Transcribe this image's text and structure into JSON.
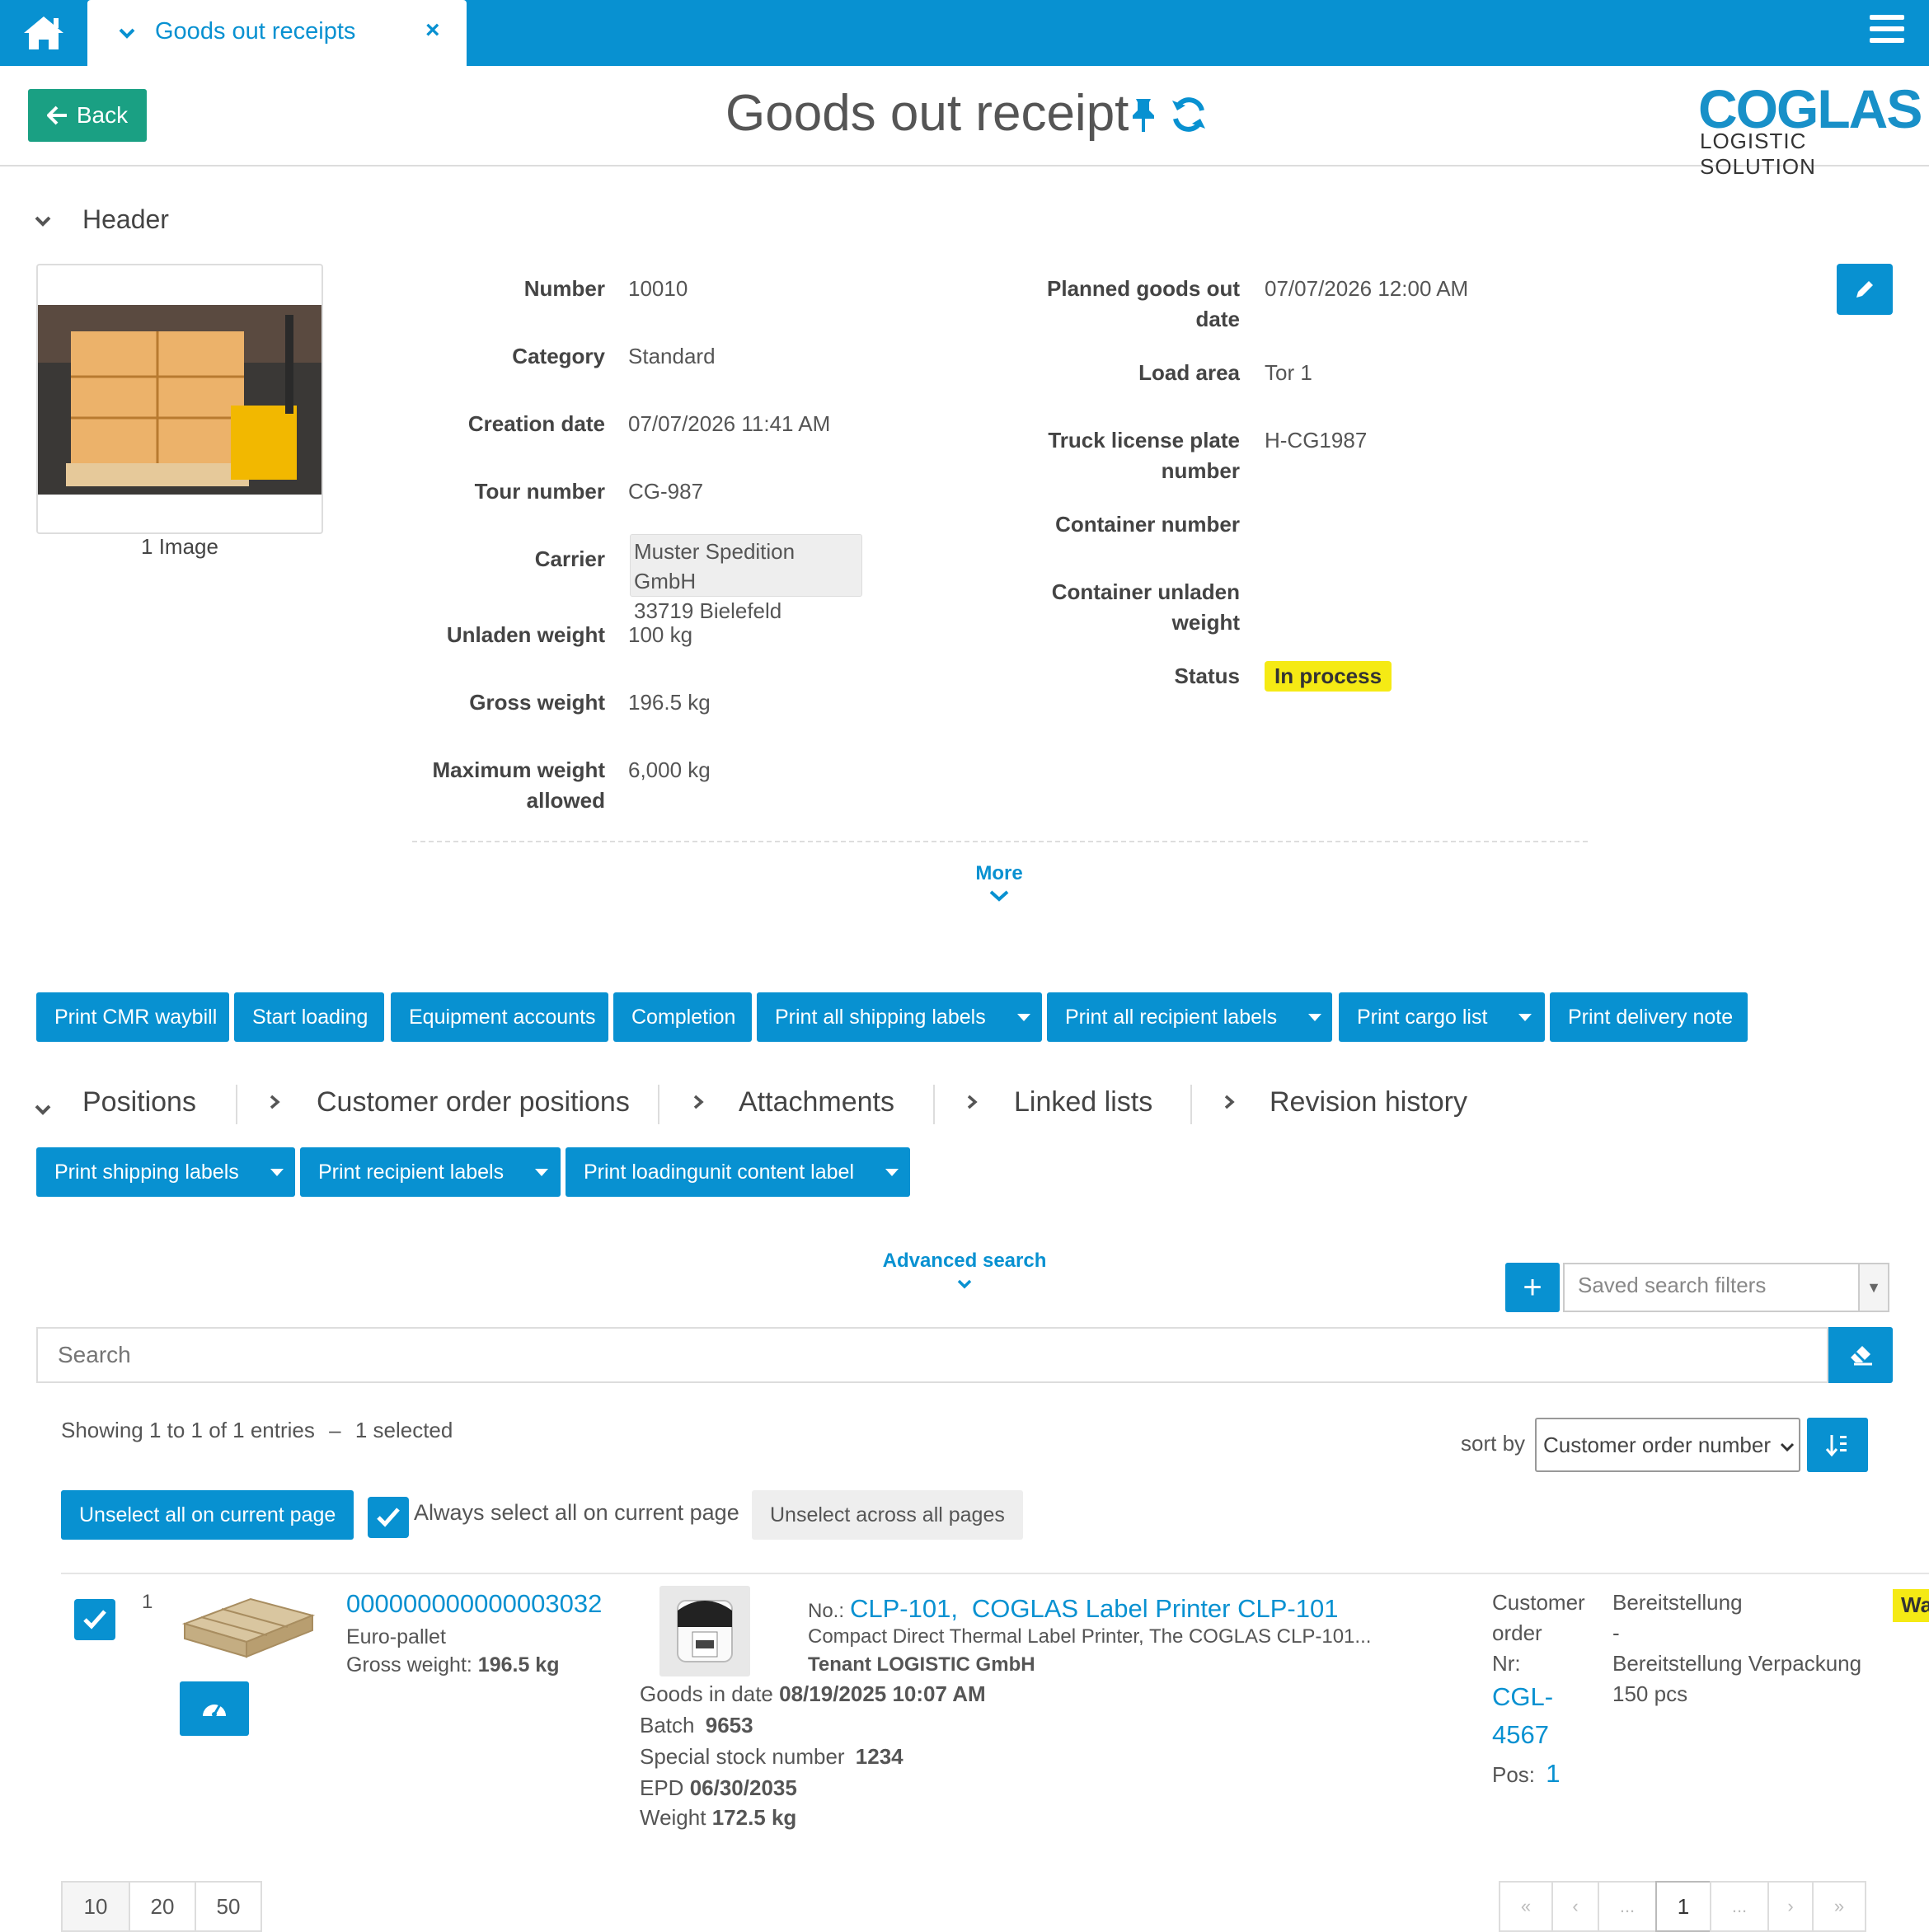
{
  "tab": {
    "label": "Goods out receipts"
  },
  "header": {
    "back_label": "Back",
    "title": "Goods out receipt",
    "logo_main": "COGLAS",
    "logo_sub": "LOGISTIC SOLUTION"
  },
  "header_section": {
    "title": "Header",
    "image_caption": "1 Image",
    "fields_left": [
      {
        "label": "Number",
        "value": "10010"
      },
      {
        "label": "Category",
        "value": "Standard"
      },
      {
        "label": "Creation date",
        "value": "07/07/2026 11:41 AM"
      },
      {
        "label": "Tour number",
        "value": "CG-987"
      },
      {
        "label": "Carrier",
        "value_line1": "Muster Spedition GmbH",
        "value_line2": "33719 Bielefeld"
      },
      {
        "label": "Unladen weight",
        "value": "100 kg"
      },
      {
        "label": "Gross weight",
        "value": "196.5 kg"
      },
      {
        "label_line1": "Maximum weight",
        "label_line2": "allowed",
        "value": "6,000 kg"
      }
    ],
    "fields_right": [
      {
        "label_line1": "Planned goods out",
        "label_line2": "date",
        "value": "07/07/2026 12:00 AM"
      },
      {
        "label": "Load area",
        "value": "Tor 1"
      },
      {
        "label_line1": "Truck license plate",
        "label_line2": "number",
        "value": "H-CG1987"
      },
      {
        "label": "Container number",
        "value": ""
      },
      {
        "label_line1": "Container unladen",
        "label_line2": "weight",
        "value": ""
      },
      {
        "label": "Status",
        "value": "In process"
      }
    ],
    "more_label": "More"
  },
  "actions": [
    "Print CMR waybill",
    "Start loading",
    "Equipment accounts",
    "Completion",
    "Print all shipping labels",
    "Print all recipient labels",
    "Print cargo list",
    "Print delivery note"
  ],
  "section_tabs": [
    "Positions",
    "Customer order positions",
    "Attachments",
    "Linked lists",
    "Revision history"
  ],
  "position_actions": [
    "Print shipping labels",
    "Print recipient labels",
    "Print loadingunit content label"
  ],
  "search": {
    "advanced_label": "Advanced search",
    "saved_placeholder": "Saved search filters",
    "placeholder": "Search"
  },
  "list": {
    "showing": "Showing 1 to 1 of 1 entries",
    "selected": "1 selected",
    "sort_by_label": "sort by",
    "sort_value": "Customer order number",
    "unselect_page": "Unselect all on current page",
    "always_select": "Always select all on current page",
    "unselect_all": "Unselect across all pages"
  },
  "row": {
    "index": "1",
    "loading_unit_number": "000000000000003032",
    "loading_unit_type": "Euro-pallet",
    "gross_weight_label": "Gross weight:",
    "gross_weight": "196.5 kg",
    "no_label": "No.:",
    "article_no": "CLP-101",
    "article_name": "COGLAS Label Printer CLP-101",
    "article_desc": "Compact Direct Thermal Label Printer, The COGLAS CLP-101...",
    "tenant": "Tenant LOGISTIC GmbH",
    "goods_in_label": "Goods in date",
    "goods_in": "08/19/2025 10:07 AM",
    "batch_label": "Batch",
    "batch": "9653",
    "special_label": "Special stock number",
    "special": "1234",
    "epd_label": "EPD",
    "epd": "06/30/2035",
    "weight_label": "Weight",
    "weight": "172.5 kg",
    "co_label1": "Customer",
    "co_label2": "order",
    "co_label3": "Nr:",
    "co_number1": "CGL-",
    "co_number2": "4567",
    "pos_label": "Pos:",
    "pos": "1",
    "provision1": "Bereitstellung",
    "provision2": "-",
    "provision3": "Bereitstellung Verpackung",
    "quantity": "150 pcs",
    "badge": "Wa"
  },
  "pagination": {
    "page_sizes": [
      "10",
      "20",
      "50"
    ],
    "nav": [
      "«",
      "‹",
      "...",
      "1",
      "...",
      "›",
      "»"
    ]
  },
  "colors": {
    "primary": "#0891d1",
    "back": "#1aa083",
    "status": "#f5ea14"
  }
}
